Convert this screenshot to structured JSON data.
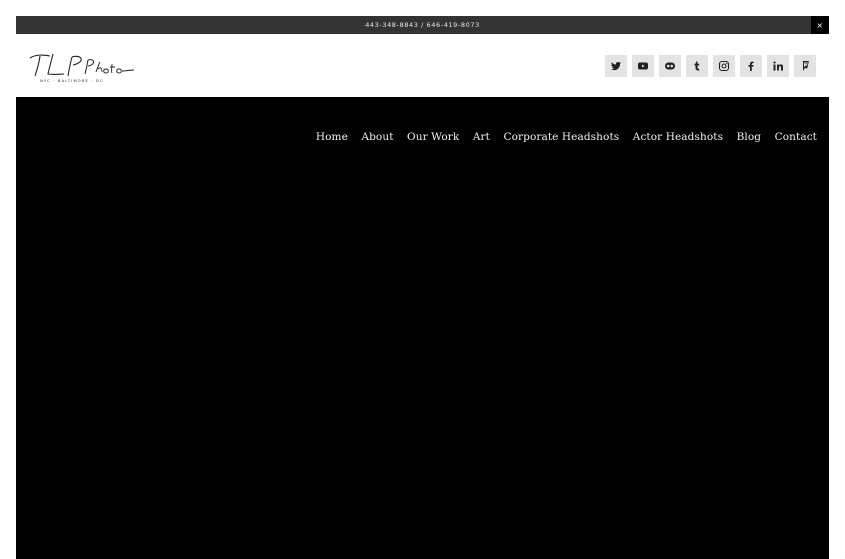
{
  "announcement": {
    "text": "443-348-8843 / 646-419-8073",
    "close_glyph": "×"
  },
  "logo": {
    "wordmark": "TLP Photo",
    "tagline": "NYC · BALTIMORE · DC"
  },
  "social": [
    {
      "name": "twitter-icon",
      "label": "Twitter"
    },
    {
      "name": "youtube-icon",
      "label": "YouTube"
    },
    {
      "name": "flickr-icon",
      "label": "Flickr"
    },
    {
      "name": "tumblr-icon",
      "label": "Tumblr"
    },
    {
      "name": "instagram-icon",
      "label": "Instagram"
    },
    {
      "name": "facebook-icon",
      "label": "Facebook"
    },
    {
      "name": "linkedin-icon",
      "label": "LinkedIn"
    },
    {
      "name": "foursquare-icon",
      "label": "Foursquare"
    }
  ],
  "nav": {
    "items": [
      "Home",
      "About",
      "Our Work",
      "Art",
      "Corporate Headshots",
      "Actor Headshots",
      "Blog",
      "Contact"
    ]
  },
  "colors": {
    "announcement_bg": "#333333",
    "hero_bg": "#000000",
    "social_bg": "#e3e3e3",
    "icon": "#222222"
  }
}
